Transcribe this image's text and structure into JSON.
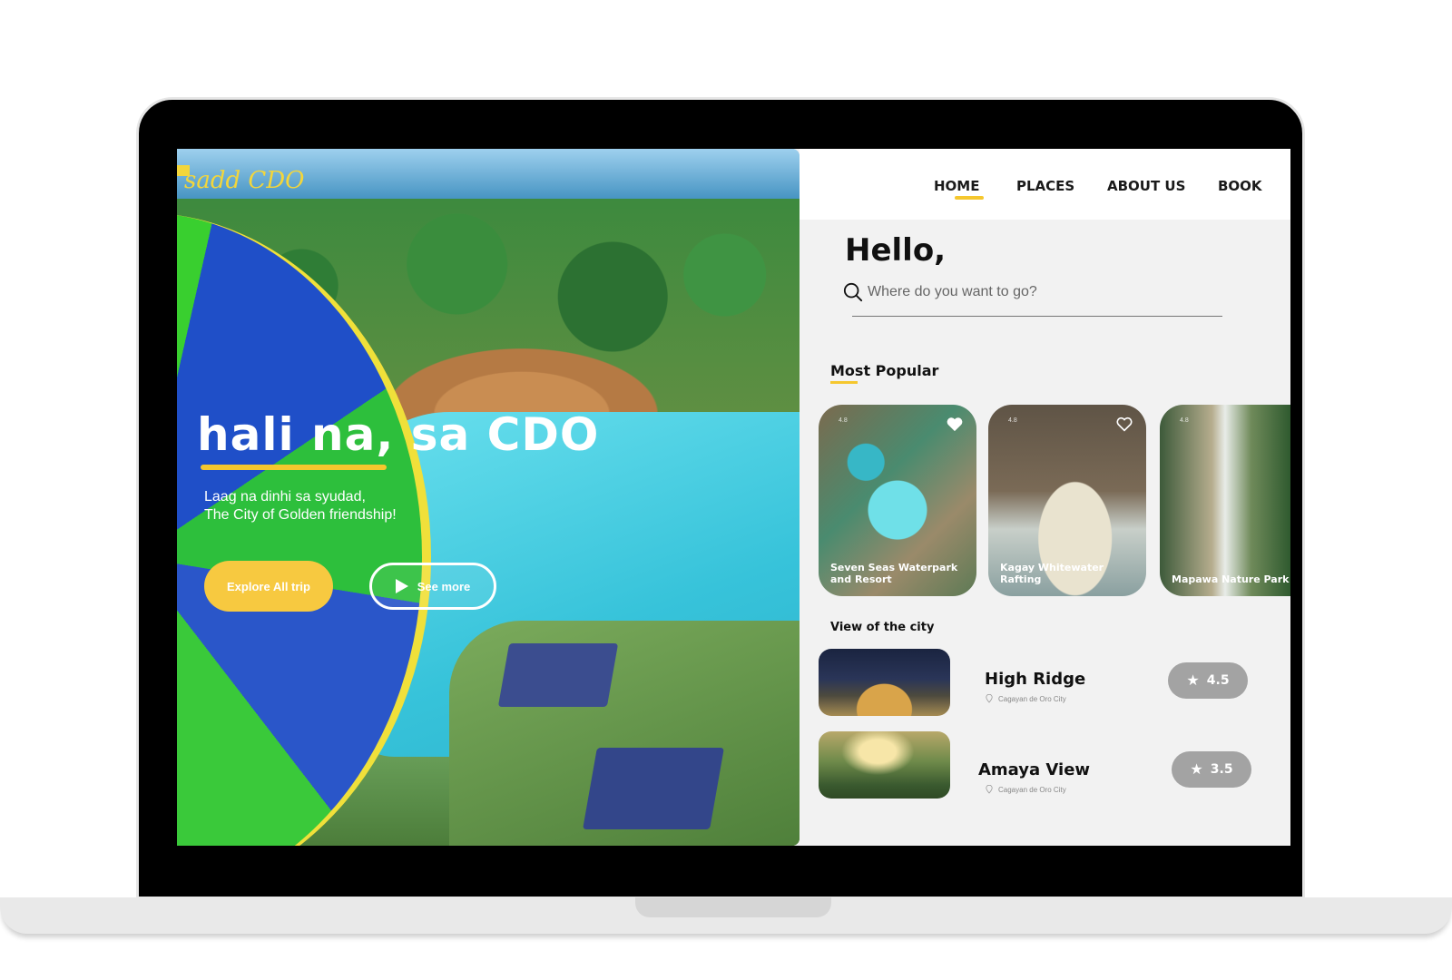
{
  "hero": {
    "brand": "sadd CDO",
    "title": "hali na, sa CDO",
    "subtitle": "Laag na dinhi sa syudad,\nThe City of Golden friendship!",
    "explore_button": "Explore All trip",
    "see_more_button": "See more"
  },
  "nav": {
    "items": [
      "HOME",
      "PLACES",
      "ABOUT US",
      "BOOK"
    ],
    "active": "HOME",
    "accent_color": "#f5c72e"
  },
  "greeting": "Hello,",
  "search": {
    "placeholder": "Where do you want to go?"
  },
  "most_popular": {
    "title": "Most Popular",
    "cards": [
      {
        "label": "Seven Seas Waterpark and Resort",
        "rating": "4.8",
        "icon": "heart-filled-icon"
      },
      {
        "label": "Kagay Whitewater Rafting",
        "rating": "4.8",
        "icon": "heart-outline-icon"
      },
      {
        "label": "Mapawa Nature Park",
        "rating": "4.8",
        "icon": "heart-outline-icon"
      }
    ]
  },
  "view_city": {
    "title": "View of the city",
    "items": [
      {
        "name": "High Ridge",
        "location": "Cagayan de Oro City",
        "rating": "4.5"
      },
      {
        "name": "Amaya View",
        "location": "Cagayan de Oro City",
        "rating": "3.5"
      }
    ]
  },
  "colors": {
    "accent": "#f5c72e",
    "explore_button": "#f7c940",
    "rating_pill": "#a3a3a3"
  }
}
